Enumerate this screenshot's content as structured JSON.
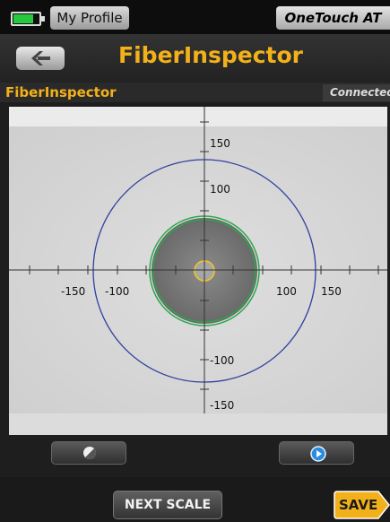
{
  "status_bar": {
    "battery_level": 0.8,
    "battery_color": "#27c93f",
    "profile_label": "My Profile",
    "device_title": "OneTouch AT"
  },
  "header": {
    "back_icon": "chevron-left-icon",
    "title": "FiberInspector"
  },
  "section": {
    "label": "FiberInspector",
    "status": "Connected"
  },
  "viewer": {
    "axis_labels": {
      "y_pos_150": "150",
      "y_pos_100": "100",
      "y_neg_100": "-100",
      "y_neg_150": "-150",
      "x_neg_150": "-150",
      "x_neg_100": "-100",
      "x_pos_100": "100",
      "x_pos_150": "150"
    },
    "rings": {
      "cladding_color": "#2f3fa0",
      "ferrule_color": "#2aa84a",
      "core_color": "#f5c518"
    }
  },
  "controls": {
    "contrast_icon": "contrast-icon",
    "play_icon": "play-icon"
  },
  "footer": {
    "next_scale_label": "NEXT SCALE",
    "save_label": "SAVE",
    "save_color": "#f2b11b"
  }
}
